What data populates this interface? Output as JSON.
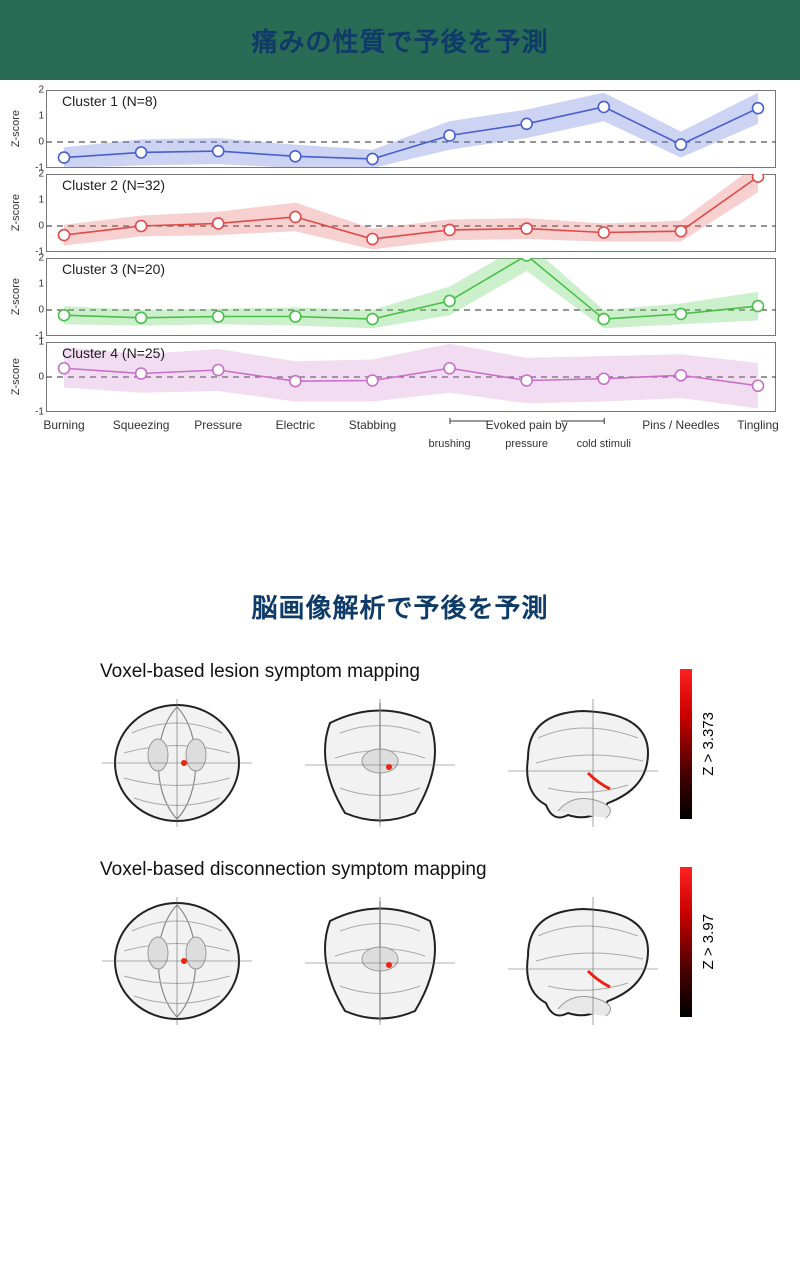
{
  "banner1_title": "痛みの性質で予後を予測",
  "banner2_title": "脳画像解析で予後を予測",
  "ylabel": "Z-score",
  "chart_data": [
    {
      "type": "line",
      "title": "Cluster 1 (N=8)",
      "ylabel": "Z-score",
      "ylim": [
        -1,
        2
      ],
      "yticks": [
        -1,
        0,
        1,
        2
      ],
      "color": "#4a5fd0",
      "fill": "rgba(110,130,220,0.35)",
      "categories": [
        "Burning",
        "Squeezing",
        "Pressure",
        "Electric",
        "Stabbing",
        "brushing",
        "pressure",
        "cold stimuli",
        "Pins / Needles",
        "Tingling"
      ],
      "values": [
        -0.6,
        -0.4,
        -0.35,
        -0.55,
        -0.65,
        0.25,
        0.7,
        1.35,
        -0.1,
        1.3
      ],
      "band_lo": [
        -1.0,
        -0.9,
        -0.85,
        -1.0,
        -1.0,
        -0.3,
        0.15,
        0.8,
        -0.6,
        0.7
      ],
      "band_hi": [
        -0.2,
        0.1,
        0.15,
        -0.1,
        -0.3,
        0.8,
        1.25,
        1.9,
        0.4,
        1.9
      ]
    },
    {
      "type": "line",
      "title": "Cluster 2 (N=32)",
      "ylabel": "Z-score",
      "ylim": [
        -1,
        2
      ],
      "yticks": [
        -1,
        0,
        1,
        2
      ],
      "color": "#e24a4a",
      "fill": "rgba(230,100,100,0.30)",
      "categories": [
        "Burning",
        "Squeezing",
        "Pressure",
        "Electric",
        "Stabbing",
        "brushing",
        "pressure",
        "cold stimuli",
        "Pins / Needles",
        "Tingling"
      ],
      "values": [
        -0.35,
        0.0,
        0.1,
        0.35,
        -0.5,
        -0.15,
        -0.1,
        -0.25,
        -0.2,
        1.9
      ],
      "band_lo": [
        -0.75,
        -0.4,
        -0.35,
        -0.2,
        -0.9,
        -0.55,
        -0.5,
        -0.6,
        -0.6,
        1.3
      ],
      "band_hi": [
        0.05,
        0.4,
        0.55,
        0.9,
        -0.1,
        0.25,
        0.3,
        0.1,
        0.2,
        2.4
      ]
    },
    {
      "type": "line",
      "title": "Cluster 3 (N=20)",
      "ylabel": "Z-score",
      "ylim": [
        -1,
        2
      ],
      "yticks": [
        -1,
        0,
        1,
        2
      ],
      "color": "#4abf4a",
      "fill": "rgba(110,210,110,0.35)",
      "categories": [
        "Burning",
        "Squeezing",
        "Pressure",
        "Electric",
        "Stabbing",
        "brushing",
        "pressure",
        "cold stimuli",
        "Pins / Needles",
        "Tingling"
      ],
      "values": [
        -0.2,
        -0.3,
        -0.25,
        -0.25,
        -0.35,
        0.35,
        2.1,
        -0.35,
        -0.15,
        0.15
      ],
      "band_lo": [
        -0.55,
        -0.6,
        -0.55,
        -0.6,
        -0.7,
        -0.2,
        1.5,
        -0.7,
        -0.55,
        -0.4
      ],
      "band_hi": [
        0.15,
        0.0,
        0.05,
        0.1,
        0.0,
        0.9,
        2.6,
        0.0,
        0.25,
        0.7
      ]
    },
    {
      "type": "line",
      "title": "Cluster 4 (N=25)",
      "ylabel": "Z-score",
      "ylim": [
        -1,
        1
      ],
      "yticks": [
        -1,
        0,
        1
      ],
      "color": "#c870c8",
      "fill": "rgba(210,140,210,0.30)",
      "categories": [
        "Burning",
        "Squeezing",
        "Pressure",
        "Electric",
        "Stabbing",
        "brushing",
        "pressure",
        "cold stimuli",
        "Pins / Needles",
        "Tingling"
      ],
      "values": [
        0.25,
        0.1,
        0.2,
        -0.12,
        -0.1,
        0.25,
        -0.1,
        -0.05,
        0.05,
        -0.25
      ],
      "band_lo": [
        -0.3,
        -0.45,
        -0.4,
        -0.7,
        -0.7,
        -0.45,
        -0.75,
        -0.7,
        -0.6,
        -0.9
      ],
      "band_hi": [
        0.85,
        0.65,
        0.8,
        0.45,
        0.5,
        0.95,
        0.55,
        0.6,
        0.65,
        0.4
      ]
    }
  ],
  "x_categories_top": [
    "Burning",
    "Squeezing",
    "Pressure",
    "Electric",
    "Stabbing"
  ],
  "x_bracket_label": "Evoked pain by",
  "x_categories_sub": [
    "brushing",
    "pressure",
    "cold stimuli"
  ],
  "x_categories_right": [
    "Pins / Needles",
    "Tingling"
  ],
  "brain": {
    "rows": [
      {
        "title": "Voxel-based lesion symptom mapping",
        "cbar": "Z > 3.373"
      },
      {
        "title": "Voxel-based disconnection symptom mapping",
        "cbar": "Z > 3.97"
      }
    ]
  }
}
